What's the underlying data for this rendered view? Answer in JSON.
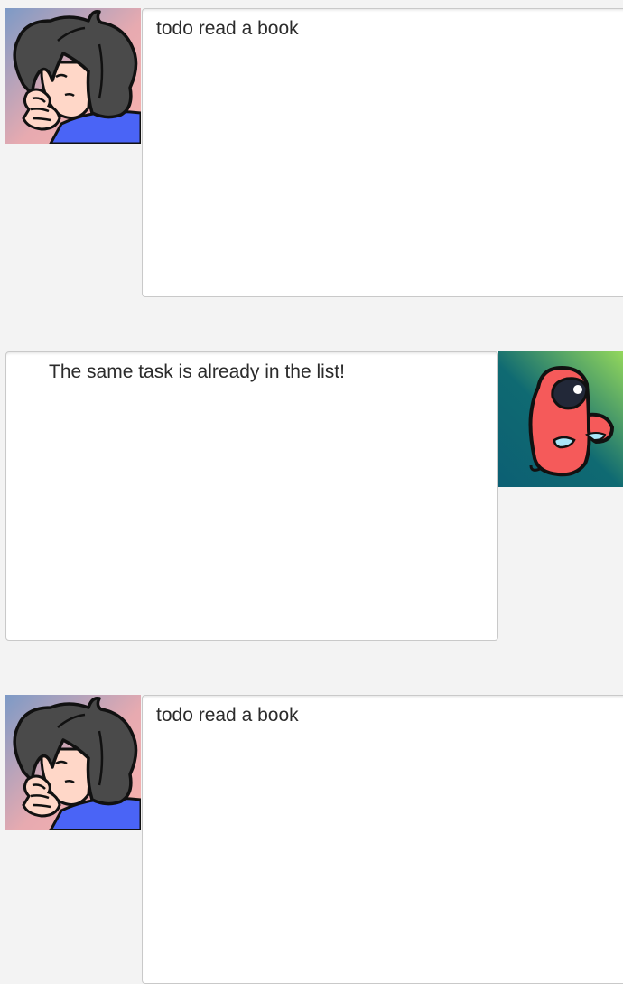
{
  "colors": {
    "background": "#f3f3f3",
    "bubble": "#ffffff",
    "bubble_border": "#c9c9c9",
    "text": "#2b2b2b"
  },
  "messages": [
    {
      "sender": "user",
      "avatar_icon": "user-avatar-icon",
      "text": "todo read a book"
    },
    {
      "sender": "bot",
      "avatar_icon": "bot-avatar-icon",
      "text": "The same task is already in the list!"
    },
    {
      "sender": "user",
      "avatar_icon": "user-avatar-icon",
      "text": "todo read a book"
    }
  ]
}
